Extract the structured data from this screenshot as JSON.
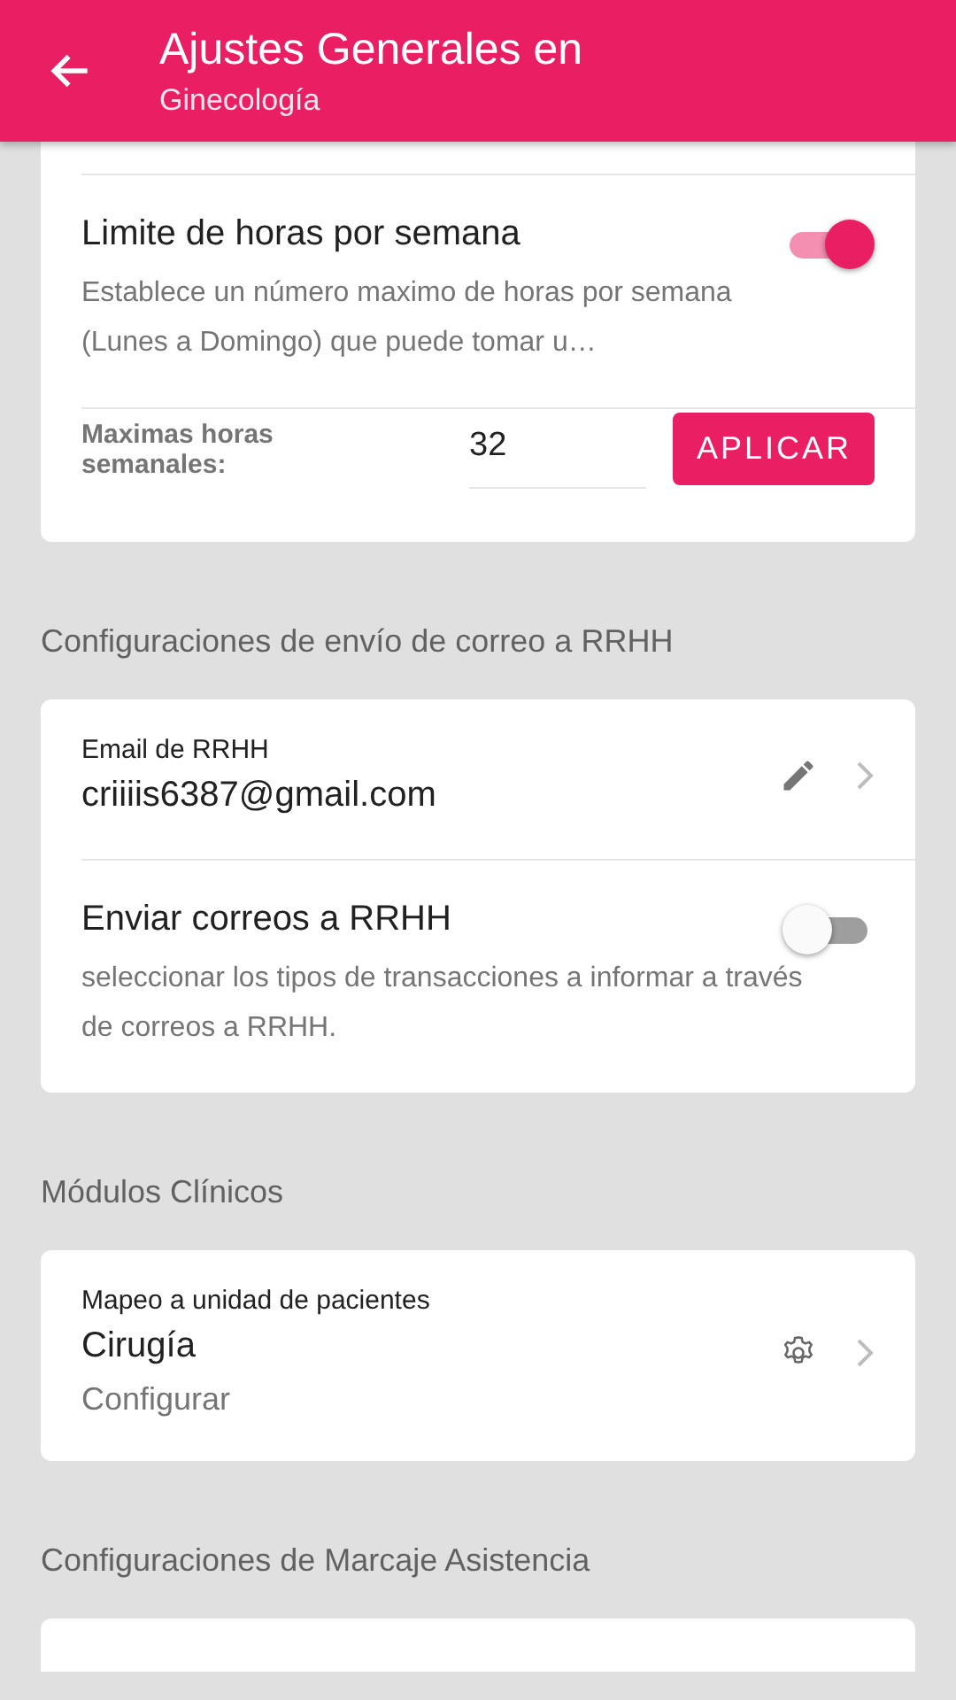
{
  "app_bar": {
    "title": "Ajustes Generales en",
    "subtitle": "Ginecología"
  },
  "top_card": {
    "rows": [
      {
        "kind": "toggle",
        "title": "Limite de horas por semana",
        "description": "Establece un número maximo de horas por semana (Lunes a Domingo) que puede tomar u…",
        "on": true
      },
      {
        "kind": "input",
        "label": "Maximas horas semanales:",
        "value": "32",
        "button": "APLICAR"
      }
    ]
  },
  "sections": [
    {
      "heading": "Configuraciones de envío de correo a RRHH",
      "rows": [
        {
          "kind": "link",
          "label": "Email de RRHH",
          "value": "criiiis6387@gmail.com"
        },
        {
          "kind": "toggle",
          "title": "Enviar correos a RRHH",
          "description": "seleccionar los tipos de transacciones a informar a través de correos a RRHH.",
          "on": false
        }
      ]
    },
    {
      "heading": "Módulos Clínicos",
      "rows": [
        {
          "kind": "module",
          "label": "Mapeo a unidad de pacientes",
          "value": "Cirugía",
          "sub": "Configurar"
        }
      ]
    },
    {
      "heading": "Configuraciones de Marcaje Asistencia"
    }
  ]
}
